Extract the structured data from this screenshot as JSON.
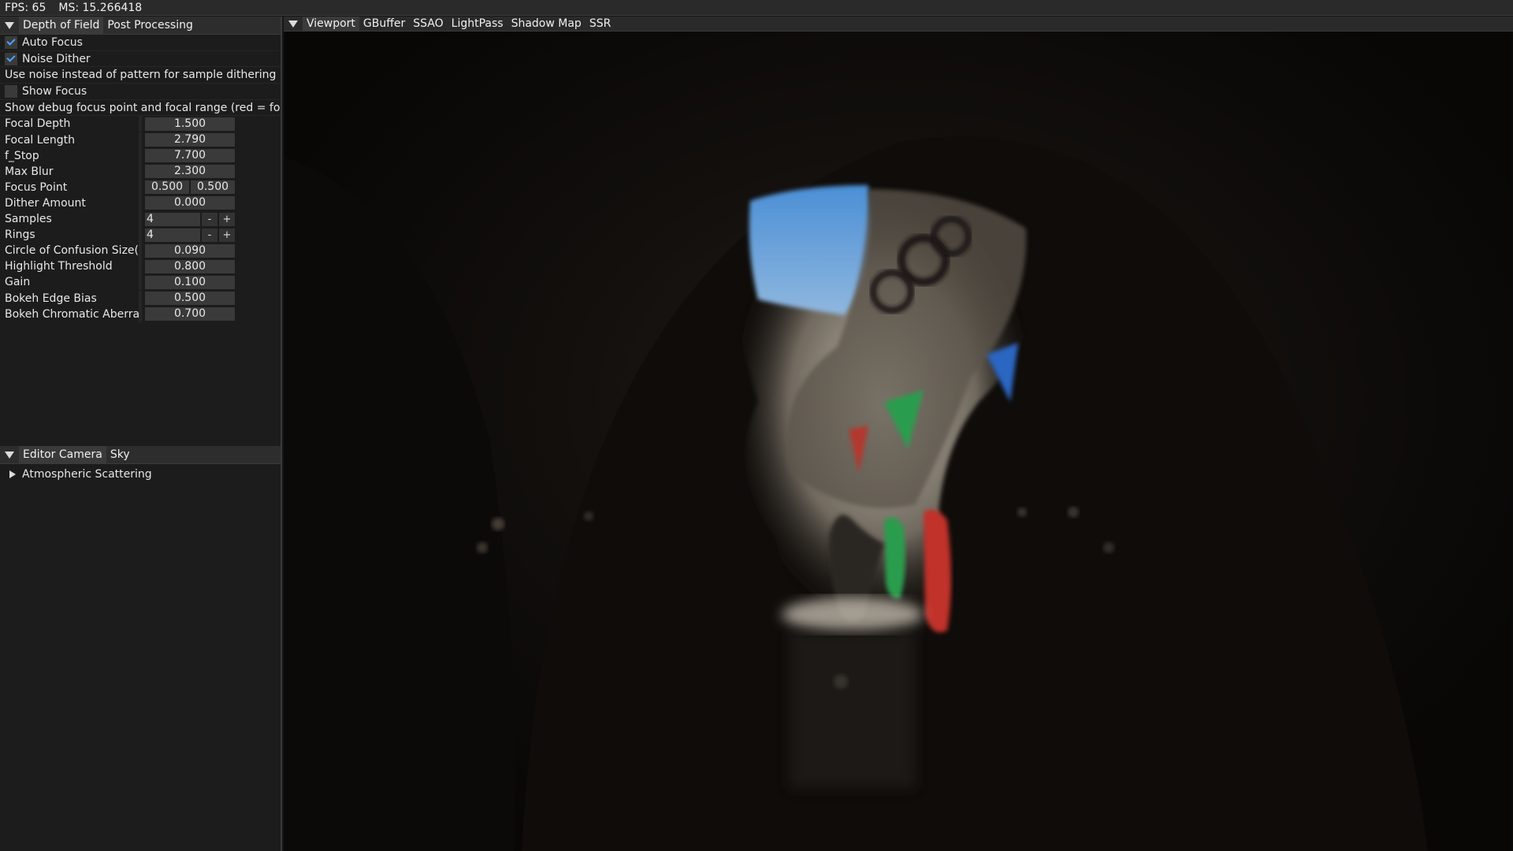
{
  "topbar": {
    "fps": "FPS: 65",
    "ms": "MS: 15.266418"
  },
  "left": {
    "tabs": [
      "Depth of Field",
      "Post Processing"
    ],
    "auto_focus": {
      "label": "Auto Focus",
      "checked": true
    },
    "noise_dither": {
      "label": "Noise Dither",
      "checked": true
    },
    "noise_desc": "Use noise instead of pattern for sample dithering",
    "show_focus": {
      "label": "Show Focus",
      "checked": false
    },
    "show_focus_desc": "Show debug focus point and focal range (red = focal p",
    "props": [
      {
        "label": "Focal Depth",
        "value": "1.500"
      },
      {
        "label": "Focal Length",
        "value": "2.790"
      },
      {
        "label": "f_Stop",
        "value": "7.700"
      },
      {
        "label": "Max Blur",
        "value": "2.300"
      }
    ],
    "focus_point": {
      "label": "Focus Point",
      "x": "0.500",
      "y": "0.500"
    },
    "dither_amount": {
      "label": "Dither Amount",
      "value": "0.000"
    },
    "samples": {
      "label": "Samples",
      "value": "4"
    },
    "rings": {
      "label": "Rings",
      "value": "4"
    },
    "props2": [
      {
        "label": "Circle of Confusion Size(mm)",
        "value": "0.090"
      },
      {
        "label": "Highlight Threshold",
        "value": "0.800"
      },
      {
        "label": "Gain",
        "value": "0.100"
      },
      {
        "label": "Bokeh Edge Bias",
        "value": "0.500"
      },
      {
        "label": "Bokeh Chromatic Aberration",
        "value": "0.700"
      }
    ],
    "camera_tabs": [
      "Editor Camera",
      "Sky"
    ],
    "atmo": "Atmospheric Scattering"
  },
  "view": {
    "tabs": [
      "Viewport",
      "GBuffer",
      "SSAO",
      "LightPass",
      "Shadow Map",
      "SSR"
    ]
  },
  "colors": {
    "accent": "#4aa3ff",
    "panel": "#1c1c1c",
    "field": "#3a3a3a"
  }
}
